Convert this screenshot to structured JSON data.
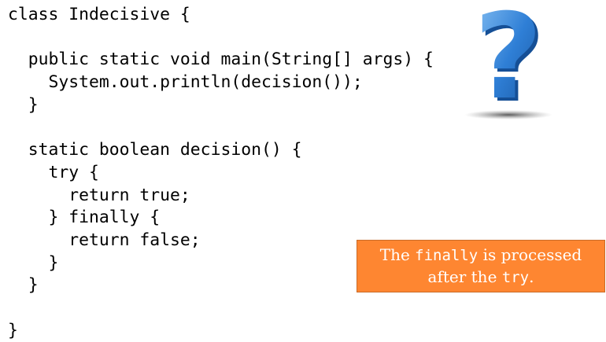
{
  "code": {
    "lines": [
      "class Indecisive {",
      "",
      "  public static void main(String[] args) {",
      "    System.out.println(decision());",
      "  }",
      "",
      "  static boolean decision() {",
      "    try {",
      "      return true;",
      "    } finally {",
      "      return false;",
      "    }",
      "  }",
      "",
      "}"
    ]
  },
  "callout": {
    "line1_pre": "The ",
    "line1_code": "finally",
    "line1_post": " is processed",
    "line2_pre": "after the ",
    "line2_code": "try",
    "line2_post": ".",
    "background": "#fe8631"
  },
  "decoration": {
    "icon": "question-mark-icon",
    "color": "#2f7fd6"
  }
}
